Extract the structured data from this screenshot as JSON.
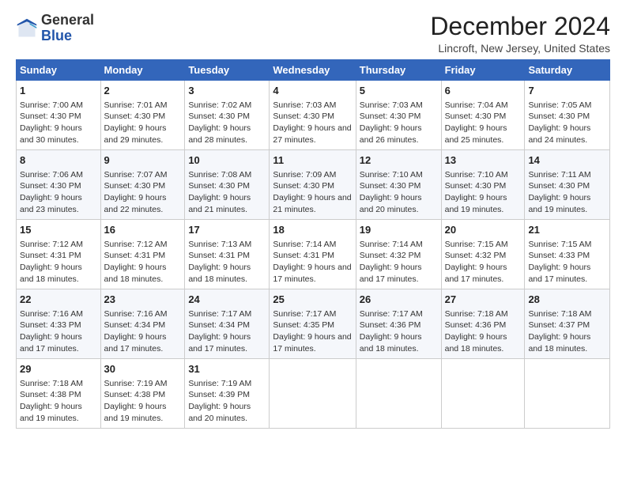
{
  "header": {
    "logo_general": "General",
    "logo_blue": "Blue",
    "title": "December 2024",
    "location": "Lincroft, New Jersey, United States"
  },
  "columns": [
    "Sunday",
    "Monday",
    "Tuesday",
    "Wednesday",
    "Thursday",
    "Friday",
    "Saturday"
  ],
  "weeks": [
    [
      {
        "day": "1",
        "sunrise": "7:00 AM",
        "sunset": "4:30 PM",
        "daylight": "9 hours and 30 minutes."
      },
      {
        "day": "2",
        "sunrise": "7:01 AM",
        "sunset": "4:30 PM",
        "daylight": "9 hours and 29 minutes."
      },
      {
        "day": "3",
        "sunrise": "7:02 AM",
        "sunset": "4:30 PM",
        "daylight": "9 hours and 28 minutes."
      },
      {
        "day": "4",
        "sunrise": "7:03 AM",
        "sunset": "4:30 PM",
        "daylight": "9 hours and 27 minutes."
      },
      {
        "day": "5",
        "sunrise": "7:03 AM",
        "sunset": "4:30 PM",
        "daylight": "9 hours and 26 minutes."
      },
      {
        "day": "6",
        "sunrise": "7:04 AM",
        "sunset": "4:30 PM",
        "daylight": "9 hours and 25 minutes."
      },
      {
        "day": "7",
        "sunrise": "7:05 AM",
        "sunset": "4:30 PM",
        "daylight": "9 hours and 24 minutes."
      }
    ],
    [
      {
        "day": "8",
        "sunrise": "7:06 AM",
        "sunset": "4:30 PM",
        "daylight": "9 hours and 23 minutes."
      },
      {
        "day": "9",
        "sunrise": "7:07 AM",
        "sunset": "4:30 PM",
        "daylight": "9 hours and 22 minutes."
      },
      {
        "day": "10",
        "sunrise": "7:08 AM",
        "sunset": "4:30 PM",
        "daylight": "9 hours and 21 minutes."
      },
      {
        "day": "11",
        "sunrise": "7:09 AM",
        "sunset": "4:30 PM",
        "daylight": "9 hours and 21 minutes."
      },
      {
        "day": "12",
        "sunrise": "7:10 AM",
        "sunset": "4:30 PM",
        "daylight": "9 hours and 20 minutes."
      },
      {
        "day": "13",
        "sunrise": "7:10 AM",
        "sunset": "4:30 PM",
        "daylight": "9 hours and 19 minutes."
      },
      {
        "day": "14",
        "sunrise": "7:11 AM",
        "sunset": "4:30 PM",
        "daylight": "9 hours and 19 minutes."
      }
    ],
    [
      {
        "day": "15",
        "sunrise": "7:12 AM",
        "sunset": "4:31 PM",
        "daylight": "9 hours and 18 minutes."
      },
      {
        "day": "16",
        "sunrise": "7:12 AM",
        "sunset": "4:31 PM",
        "daylight": "9 hours and 18 minutes."
      },
      {
        "day": "17",
        "sunrise": "7:13 AM",
        "sunset": "4:31 PM",
        "daylight": "9 hours and 18 minutes."
      },
      {
        "day": "18",
        "sunrise": "7:14 AM",
        "sunset": "4:31 PM",
        "daylight": "9 hours and 17 minutes."
      },
      {
        "day": "19",
        "sunrise": "7:14 AM",
        "sunset": "4:32 PM",
        "daylight": "9 hours and 17 minutes."
      },
      {
        "day": "20",
        "sunrise": "7:15 AM",
        "sunset": "4:32 PM",
        "daylight": "9 hours and 17 minutes."
      },
      {
        "day": "21",
        "sunrise": "7:15 AM",
        "sunset": "4:33 PM",
        "daylight": "9 hours and 17 minutes."
      }
    ],
    [
      {
        "day": "22",
        "sunrise": "7:16 AM",
        "sunset": "4:33 PM",
        "daylight": "9 hours and 17 minutes."
      },
      {
        "day": "23",
        "sunrise": "7:16 AM",
        "sunset": "4:34 PM",
        "daylight": "9 hours and 17 minutes."
      },
      {
        "day": "24",
        "sunrise": "7:17 AM",
        "sunset": "4:34 PM",
        "daylight": "9 hours and 17 minutes."
      },
      {
        "day": "25",
        "sunrise": "7:17 AM",
        "sunset": "4:35 PM",
        "daylight": "9 hours and 17 minutes."
      },
      {
        "day": "26",
        "sunrise": "7:17 AM",
        "sunset": "4:36 PM",
        "daylight": "9 hours and 18 minutes."
      },
      {
        "day": "27",
        "sunrise": "7:18 AM",
        "sunset": "4:36 PM",
        "daylight": "9 hours and 18 minutes."
      },
      {
        "day": "28",
        "sunrise": "7:18 AM",
        "sunset": "4:37 PM",
        "daylight": "9 hours and 18 minutes."
      }
    ],
    [
      {
        "day": "29",
        "sunrise": "7:18 AM",
        "sunset": "4:38 PM",
        "daylight": "9 hours and 19 minutes."
      },
      {
        "day": "30",
        "sunrise": "7:19 AM",
        "sunset": "4:38 PM",
        "daylight": "9 hours and 19 minutes."
      },
      {
        "day": "31",
        "sunrise": "7:19 AM",
        "sunset": "4:39 PM",
        "daylight": "9 hours and 20 minutes."
      },
      null,
      null,
      null,
      null
    ]
  ]
}
